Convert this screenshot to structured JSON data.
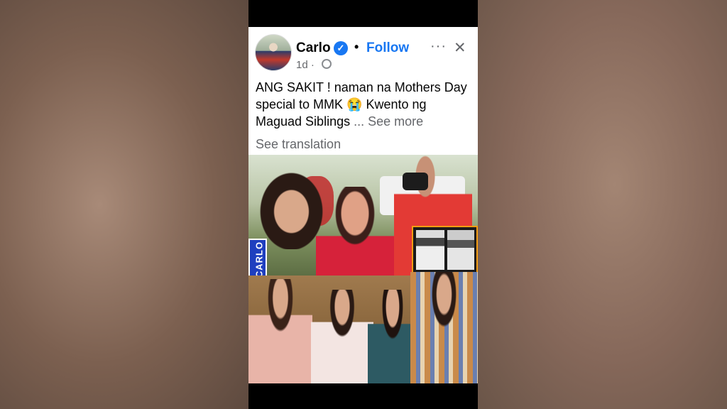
{
  "post": {
    "author": "Carlo",
    "follow_label": "Follow",
    "separator": "•",
    "more_icon": "···",
    "close_icon": "✕",
    "verified_icon": "✓",
    "time": "1d ·",
    "caption_main": "ANG SAKIT ! naman na Mothers Day special to MMK 😭 Kwento ng Maguad Siblings",
    "caption_ellipsis": "...",
    "see_more": "See more",
    "see_translation": "See translation"
  },
  "media": {
    "tag_label": "CARLO"
  },
  "colors": {
    "accent": "#1877f2",
    "tag": "#1f3fbf",
    "inset_border": "#f39c12"
  }
}
